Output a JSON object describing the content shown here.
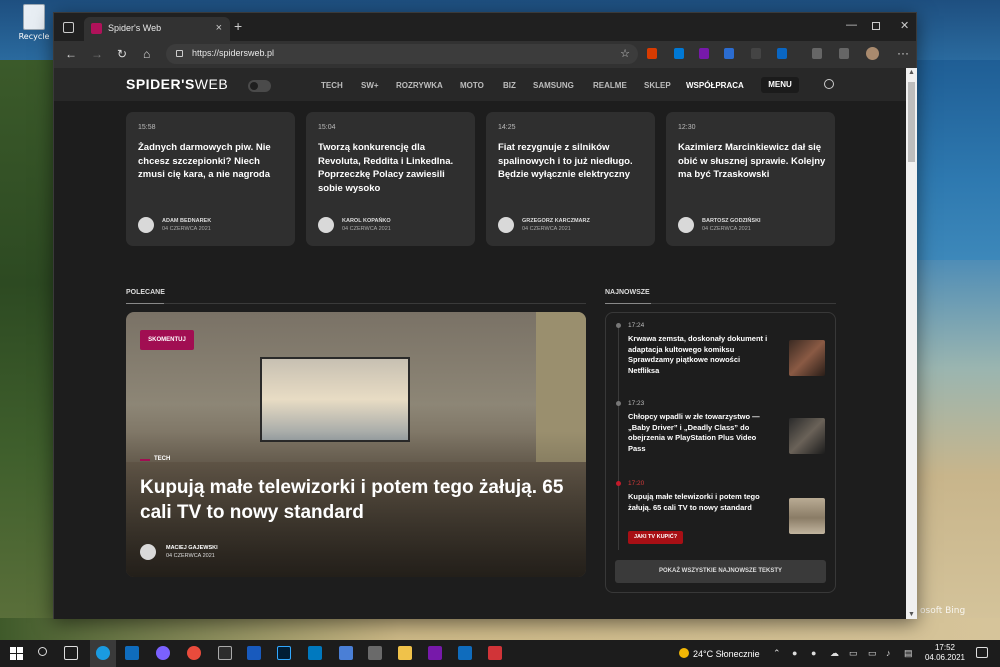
{
  "desktop": {
    "recycle_label": "Recycle",
    "bing_text": "osoft Bing"
  },
  "browser": {
    "tab_title": "Spider's Web",
    "tab_close": "×",
    "new_tab": "+",
    "url": "https://spidersweb.pl",
    "more": "···"
  },
  "site": {
    "logo_bold": "SPIDER'S",
    "logo_light": "WEB",
    "nav": [
      "TECH",
      "SW+",
      "ROZRYWKA",
      "MOTO",
      "BIZ",
      "SAMSUNG",
      "REALME",
      "SKLEP",
      "WSPÓŁPRACA"
    ],
    "menu_label": "MENU",
    "cards": [
      {
        "time": "15:58",
        "headline": "Żadnych darmowych piw. Nie chcesz szczepionki? Niech zmusi cię kara, a nie nagroda",
        "author": "ADAM BEDNAREK",
        "date": "04 CZERWCA 2021"
      },
      {
        "time": "15:04",
        "headline": "Tworzą konkurencję dla Revoluta, Reddita i LinkedIna. Poprzeczkę Polacy zawiesili sobie wysoko",
        "author": "KAROL KOPAŃKO",
        "date": "04 CZERWCA 2021"
      },
      {
        "time": "14:25",
        "headline": "Fiat rezygnuje z silników spalinowych i to już niedługo. Będzie wyłącznie elektryczny",
        "author": "GRZEGORZ KARCZMARZ",
        "date": "04 CZERWCA 2021"
      },
      {
        "time": "12:30",
        "headline": "Kazimierz Marcinkiewicz dał się obić w słusznej sprawie. Kolejny ma być Trzaskowski",
        "author": "BARTOSZ GODZIŃSKI",
        "date": "04 CZERWCA 2021"
      }
    ],
    "section_polecane": "POLECANE",
    "section_najnowsze": "NAJNOWSZE",
    "hero": {
      "badge": "SKOMENTUJ",
      "category": "TECH",
      "title": "Kupują małe telewizorki i potem tego żałują. 65 cali TV to nowy standard",
      "author": "MACIEJ GAJEWSKI",
      "date": "04 CZERWCA 2021"
    },
    "latest": [
      {
        "time": "17:24",
        "headline": "Krwawa zemsta, doskonały dokument i adaptacja kultowego komiksu Sprawdzamy piątkowe nowości Netfliksa"
      },
      {
        "time": "17:23",
        "headline": "Chłopcy wpadli w złe towarzystwo — „Baby Driver” i „Deadly Class” do obejrzenia w PlayStation Plus Video Pass"
      },
      {
        "time": "17:20",
        "headline": "Kupują małe telewizorki i potem tego żałują. 65 cali TV to nowy standard",
        "tag": "JAKI TV KUPIĆ?"
      }
    ],
    "show_all": "POKAŻ WSZYSTKIE NAJNOWSZE TEKSTY"
  },
  "taskbar": {
    "weather": "24°C Słonecznie",
    "time": "17:52",
    "date": "04.06.2021"
  },
  "colors": {
    "accent": "#a10e52",
    "tag_red": "#a80f15"
  }
}
